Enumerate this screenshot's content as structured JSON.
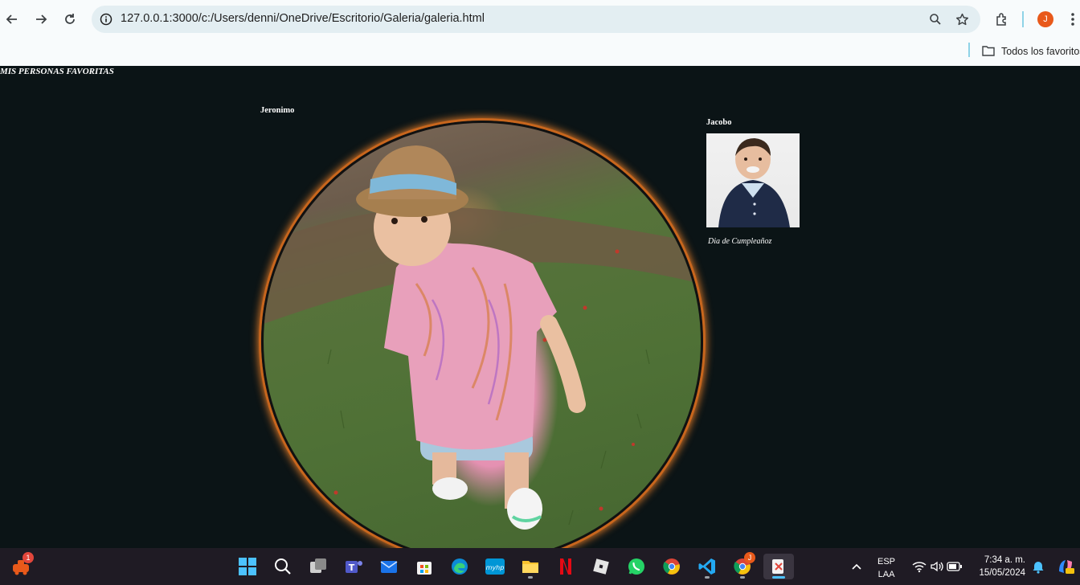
{
  "browser": {
    "url": "127.0.0.1:3000/c:/Users/denni/OneDrive/Escritorio/Galeria/galeria.html",
    "bookmarks_folder": "Todos los favoritos",
    "profile_initial": "J",
    "icons": [
      "back-icon",
      "forward-icon",
      "reload-icon",
      "site-info-icon",
      "zoom-icon",
      "star-icon",
      "extensions-icon",
      "menu-icon",
      "folder-icon"
    ]
  },
  "page": {
    "title": "MIS PERSONAS FAVORITAS",
    "gallery": [
      {
        "name": "Jeronimo",
        "photo": "boy-in-hat-on-grass-photo"
      },
      {
        "name": "Jacobo",
        "photo": "boy-portrait-photo",
        "caption": "Dia de Cumpleañoz"
      }
    ],
    "colors": {
      "background": "#0b1416",
      "frame_glow": "#e07a28"
    }
  },
  "taskbar": {
    "apps": [
      "start",
      "search",
      "task-view",
      "teams",
      "mail",
      "store",
      "edge",
      "myhp",
      "file-explorer",
      "netflix",
      "roblox",
      "whatsapp",
      "chrome",
      "vscode",
      "chrome-profile",
      "snipping-tool"
    ],
    "left_badge": "1",
    "chrome_badge": "J",
    "language": "ESP",
    "layout": "LAA",
    "time": "7:34 a. m.",
    "date": "15/05/2024"
  }
}
